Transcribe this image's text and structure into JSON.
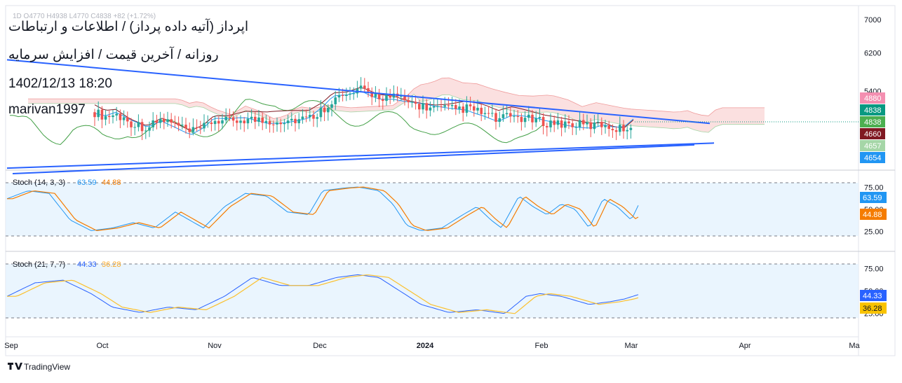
{
  "overlay": {
    "title": "اپرداز (آتیه داده پرداز) / اطلاعات و ارتباطات",
    "subtitle": "روزانه / آخرین قیمت / افزایش سرمایه",
    "datetime": "1402/12/13 18:20",
    "author": "marivan1997",
    "ohlc_line": "1D  O4770  H4938  L4770  C4838  +82 (+1.72%)"
  },
  "brand": {
    "name": "TradingView"
  },
  "colors": {
    "up": "#26a69a",
    "down": "#ef5350",
    "trendline": "#2962ff",
    "kijun": "#801922",
    "tenkan": "#2196f3",
    "chikou": "#43a047",
    "cloud_bear": "#f8c6c6",
    "cloud_bull": "#c8e6c9",
    "stoch_k1": "#2196f3",
    "stoch_d1": "#f57c00",
    "stoch_k2": "#2962ff",
    "stoch_d2": "#fbc02d",
    "band": "#e3f2fd"
  },
  "chart_data": [
    {
      "type": "candlestick",
      "title": "اپرداز (آتیه داده پرداز) / اطلاعات و ارتباطات",
      "interval": "1D",
      "scale": "log",
      "ylim": [
        4400,
        7200
      ],
      "y_ticks": [
        7000,
        6200,
        5400
      ],
      "x_ticks": [
        "Sep",
        "Oct",
        "Nov",
        "Dec",
        "2024",
        "Feb",
        "Mar",
        "Apr",
        "Ma"
      ],
      "last": {
        "open": 4770,
        "high": 4938,
        "low": 4770,
        "close": 4838,
        "change": 82,
        "change_pct": 1.72
      },
      "price_badges": [
        {
          "value": "4880",
          "color": "#f48fb1"
        },
        {
          "value": "4838",
          "color": "#089981"
        },
        {
          "value": "4838",
          "color": "#4caf50"
        },
        {
          "value": "4660",
          "color": "#801922"
        },
        {
          "value": "4657",
          "color": "#a5d6a7"
        },
        {
          "value": "4654",
          "color": "#2196f3"
        }
      ],
      "trendlines": [
        {
          "from": [
            "Sep",
            6050
          ],
          "to": [
            "Mar-end",
            4800
          ]
        },
        {
          "from": [
            "Sep",
            4080
          ],
          "to": [
            "Mar-end",
            4470
          ]
        },
        {
          "from": [
            "Sep",
            4000
          ],
          "to": [
            "Mar-end",
            4440
          ]
        }
      ],
      "indicators": [
        "Ichimoku Cloud"
      ]
    },
    {
      "type": "line",
      "title": "Stoch (14, 3, 3)",
      "ylim": [
        0,
        100
      ],
      "y_ticks": [
        75,
        50,
        25
      ],
      "band": [
        20,
        80
      ],
      "series": [
        {
          "name": "%K",
          "last": "63.59"
        },
        {
          "name": "%D",
          "last": "44.88"
        }
      ]
    },
    {
      "type": "line",
      "title": "Stoch (21, 7, 7)",
      "ylim": [
        0,
        100
      ],
      "y_ticks": [
        75,
        50,
        25
      ],
      "band": [
        20,
        80
      ],
      "series": [
        {
          "name": "%K",
          "last": "44.33"
        },
        {
          "name": "%D",
          "last": "36.28"
        }
      ]
    }
  ]
}
